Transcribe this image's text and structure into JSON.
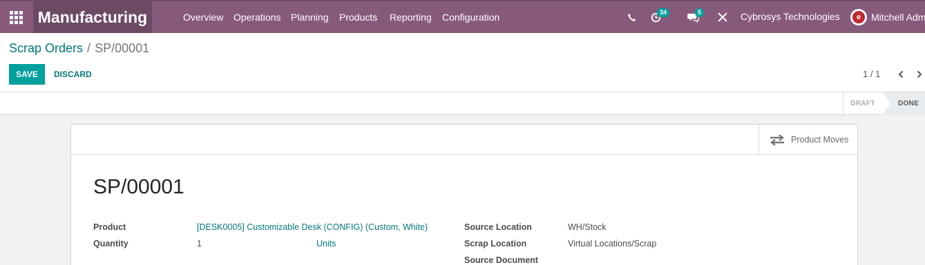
{
  "navbar": {
    "app_name": "Manufacturing",
    "menu": [
      "Overview",
      "Operations",
      "Planning",
      "Products",
      "Reporting",
      "Configuration"
    ],
    "activity_count": "34",
    "message_count": "5",
    "company": "Cybrosys Technologies",
    "user": "Mitchell Admin",
    "avatar_letter": "e",
    "bg_color": "#875a7b"
  },
  "breadcrumb": {
    "parent": "Scrap Orders",
    "separator": "/",
    "current": "SP/00001"
  },
  "buttons": {
    "save": "SAVE",
    "discard": "DISCARD"
  },
  "pager": {
    "value": "1 / 1"
  },
  "statusbar": {
    "draft": "DRAFT",
    "done": "DONE",
    "active": "DONE"
  },
  "smart_button": {
    "label": "Product Moves",
    "icon": "exchange-icon"
  },
  "form": {
    "name": "SP/00001",
    "product_label": "Product",
    "product_value": "[DESK0005] Customizable Desk (CONFIG) (Custom, White)",
    "quantity_label": "Quantity",
    "quantity_value": "1",
    "uom_value": "Units",
    "source_location_label": "Source Location",
    "source_location_value": "WH/Stock",
    "scrap_location_label": "Scrap Location",
    "scrap_location_value": "Virtual Locations/Scrap",
    "source_document_label": "Source Document",
    "source_document_value": ""
  }
}
